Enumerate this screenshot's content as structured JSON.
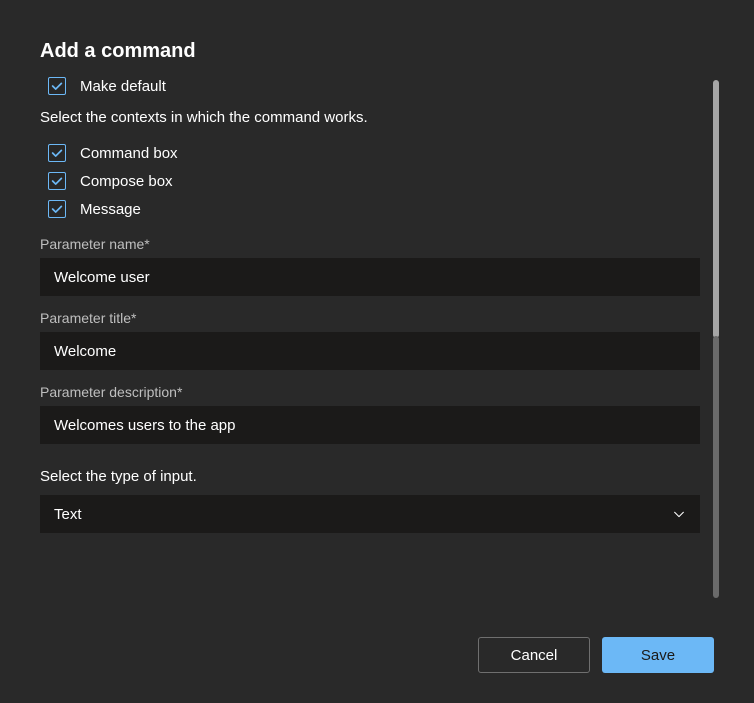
{
  "title": "Add a command",
  "make_default": {
    "label": "Make default",
    "checked": true
  },
  "contexts_help": "Select the contexts in which the command works.",
  "contexts": [
    {
      "label": "Command box",
      "checked": true
    },
    {
      "label": "Compose box",
      "checked": true
    },
    {
      "label": "Message",
      "checked": true
    }
  ],
  "fields": {
    "param_name": {
      "label": "Parameter name*",
      "value": "Welcome user"
    },
    "param_title": {
      "label": "Parameter title*",
      "value": "Welcome"
    },
    "param_desc": {
      "label": "Parameter description*",
      "value": "Welcomes users to the app"
    }
  },
  "input_type": {
    "label": "Select the type of input.",
    "value": "Text"
  },
  "buttons": {
    "cancel": "Cancel",
    "save": "Save"
  }
}
